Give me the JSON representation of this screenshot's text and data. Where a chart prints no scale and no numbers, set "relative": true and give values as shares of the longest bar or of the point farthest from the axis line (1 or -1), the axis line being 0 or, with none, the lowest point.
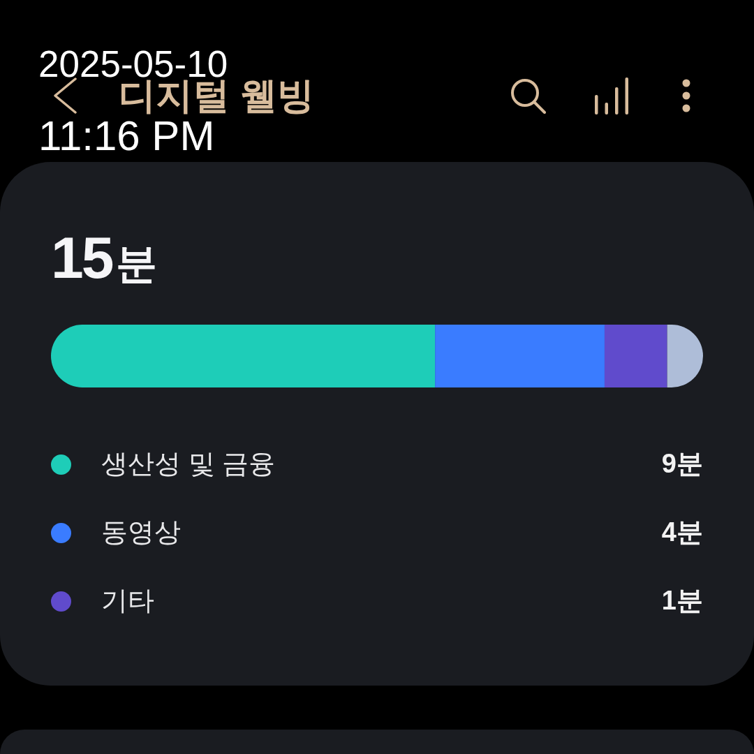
{
  "timestamp": {
    "date": "2025-05-10",
    "time": "11:16 PM"
  },
  "header": {
    "title": "디지털 웰빙"
  },
  "summary": {
    "total": {
      "value": "15",
      "unit": "분"
    },
    "usage_bar": {
      "chart_data": {
        "type": "bar",
        "orientation": "horizontal",
        "stacked": true,
        "relative": true,
        "series": [
          {
            "color": "#1ecdb8",
            "values": [
              0.589
            ]
          },
          {
            "color": "#3a7cff",
            "values": [
              0.26
            ]
          },
          {
            "color": "#604bcc",
            "values": [
              0.096
            ]
          },
          {
            "color": "#aebdd8",
            "values": [
              0.055
            ]
          }
        ]
      }
    },
    "categories": [
      {
        "name": "생산성 및 금융",
        "time": "9분",
        "color": "#1ecdb8"
      },
      {
        "name": "동영상",
        "time": "4분",
        "color": "#3a7cff"
      },
      {
        "name": "기타",
        "time": "1분",
        "color": "#604bcc"
      }
    ]
  }
}
